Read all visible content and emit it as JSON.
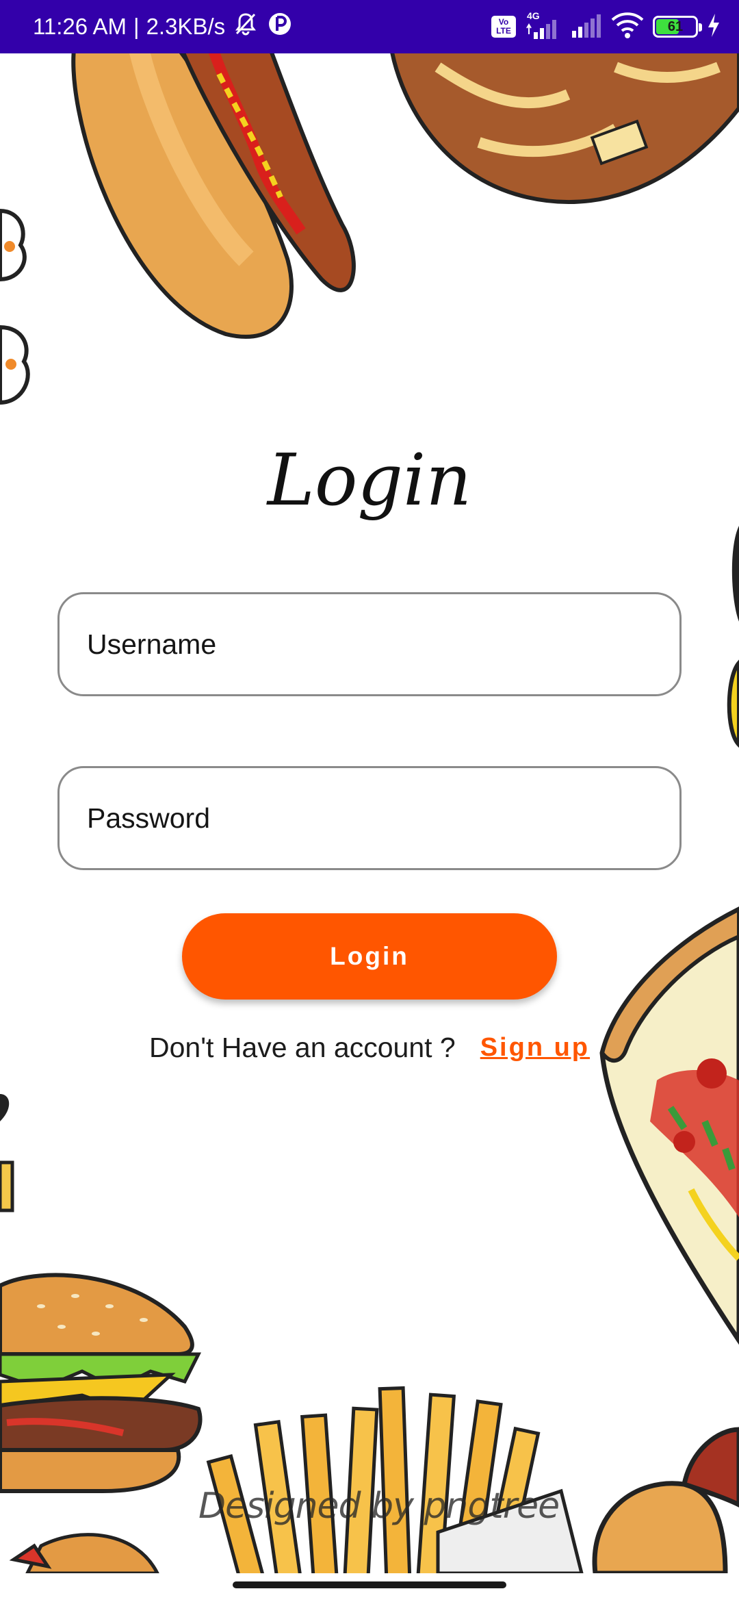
{
  "status_bar": {
    "time": "11:26 AM",
    "separator": "|",
    "speed": "2.3KB/s",
    "volte_top": "Vo",
    "volte_bottom": "LTE",
    "network_type": "4G",
    "battery_level": "61",
    "battery_fraction": 0.61,
    "icons": [
      "mute-bell-icon",
      "app-notification-icon",
      "volte-icon",
      "signal-icon",
      "wifi-icon",
      "battery-icon",
      "charging-icon"
    ]
  },
  "login": {
    "title": "Login",
    "username_placeholder": "Username",
    "password_placeholder": "Password",
    "login_button": "Login",
    "signup_prompt": "Don't Have an account ?",
    "signup_link": "Sign up"
  },
  "background": {
    "watermark": "Designed by pngtree",
    "food_items": [
      "hotdog",
      "pretzel",
      "pizza-slice",
      "burger",
      "french-fries"
    ]
  },
  "colors": {
    "status_bar": "#3300aa",
    "accent": "#ff5600",
    "text": "#1c1c1c",
    "field_border": "#8a8a8a"
  }
}
